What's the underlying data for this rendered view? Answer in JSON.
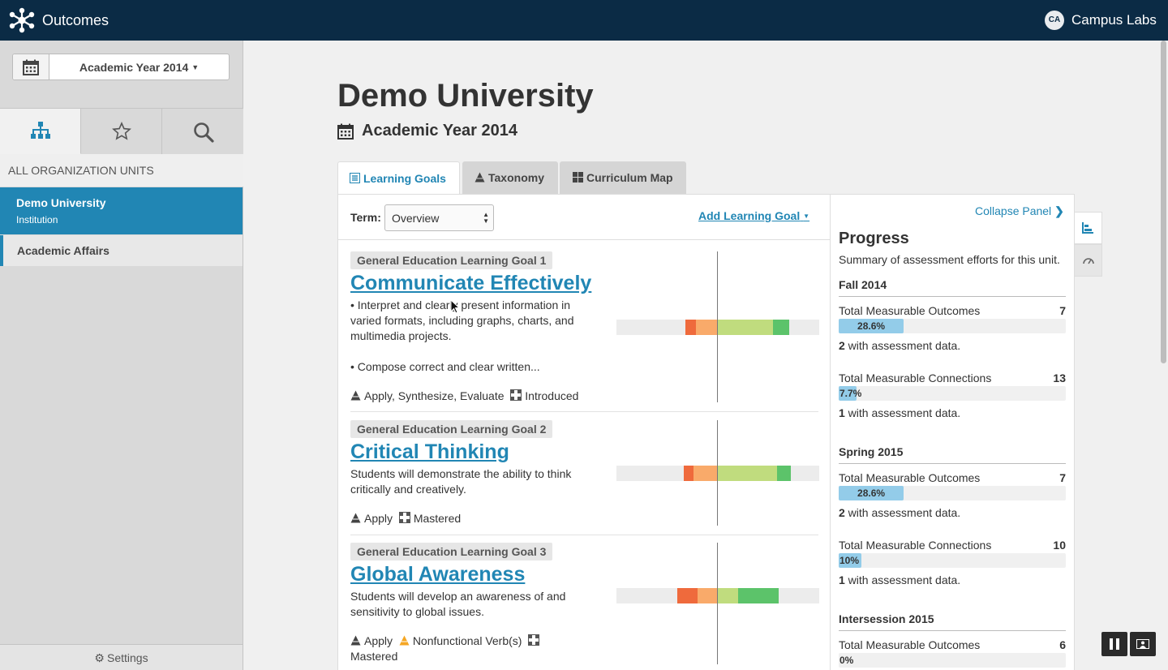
{
  "topbar": {
    "app_title": "Outcomes",
    "avatar_initials": "CA",
    "org_name": "Campus Labs"
  },
  "sidebar": {
    "year_label": "Academic Year 2014",
    "tabs": [
      "hierarchy-icon",
      "star-icon",
      "search-icon"
    ],
    "units_header": "ALL ORGANIZATION UNITS",
    "units": [
      {
        "name": "Demo University",
        "type": "Institution",
        "active": true
      },
      {
        "name": "Academic Affairs",
        "type": "",
        "active": false
      }
    ],
    "settings_label": "Settings"
  },
  "main": {
    "title": "Demo University",
    "subtitle": "Academic Year 2014",
    "tabs": [
      {
        "label": "Learning Goals",
        "icon": "list-icon",
        "active": true
      },
      {
        "label": "Taxonomy",
        "icon": "pyramid-icon",
        "active": false
      },
      {
        "label": "Curriculum Map",
        "icon": "grid-icon",
        "active": false
      }
    ],
    "term_label": "Term:",
    "term_value": "Overview",
    "add_goal_label": "Add Learning Goal",
    "goals": [
      {
        "badge": "General Education Learning Goal 1",
        "title": "Communicate Effectively",
        "desc_1": "• Interpret and clearly present information in varied formats, including graphs, charts, and multimedia projects.",
        "desc_2": "• Compose correct and clear written...",
        "taxonomy": "Apply, Synthesize, Evaluate",
        "level": "Introduced",
        "distribution": [
          0.05,
          0.11,
          0.27,
          0.08
        ]
      },
      {
        "badge": "General Education Learning Goal 2",
        "title": "Critical Thinking",
        "desc_1": "Students will demonstrate the ability to think critically and creatively.",
        "taxonomy": "Apply",
        "level": "Mastered",
        "distribution": [
          0.05,
          0.12,
          0.29,
          0.07
        ]
      },
      {
        "badge": "General Education Learning Goal 3",
        "title": "Global Awareness",
        "desc_1": "Students will develop an awareness of and sensitivity to global issues.",
        "taxonomy": "Apply",
        "warning": "Nonfunctional Verb(s)",
        "level": "Mastered",
        "distribution": [
          0.1,
          0.1,
          0.1,
          0.2
        ]
      }
    ]
  },
  "progress": {
    "collapse_label": "Collapse Panel",
    "title": "Progress",
    "subtitle": "Summary of assessment efforts for this unit.",
    "terms": [
      {
        "name": "Fall 2014",
        "metrics": [
          {
            "label": "Total Measurable Outcomes",
            "count": "7",
            "pct": "28.6%",
            "fraction": 0.286,
            "with_count": "2",
            "with_text": " with assessment data."
          },
          {
            "label": "Total Measurable Connections",
            "count": "13",
            "pct": "7.7%",
            "fraction": 0.077,
            "with_count": "1",
            "with_text": " with assessment data."
          }
        ]
      },
      {
        "name": "Spring 2015",
        "metrics": [
          {
            "label": "Total Measurable Outcomes",
            "count": "7",
            "pct": "28.6%",
            "fraction": 0.286,
            "with_count": "2",
            "with_text": " with assessment data."
          },
          {
            "label": "Total Measurable Connections",
            "count": "10",
            "pct": "10%",
            "fraction": 0.1,
            "with_count": "1",
            "with_text": " with assessment data."
          }
        ]
      },
      {
        "name": "Intersession 2015",
        "metrics": [
          {
            "label": "Total Measurable Outcomes",
            "count": "6",
            "pct": "0%",
            "fraction": 0
          }
        ]
      }
    ]
  },
  "colors": {
    "nav_bg": "#0b2b45",
    "accent": "#2186b4",
    "bar_red": "#ef6a3c",
    "bar_orange": "#f9aa6a",
    "bar_lightgreen": "#c0dc7e",
    "bar_green": "#5cc36a",
    "progress_fill": "#93cce9"
  }
}
